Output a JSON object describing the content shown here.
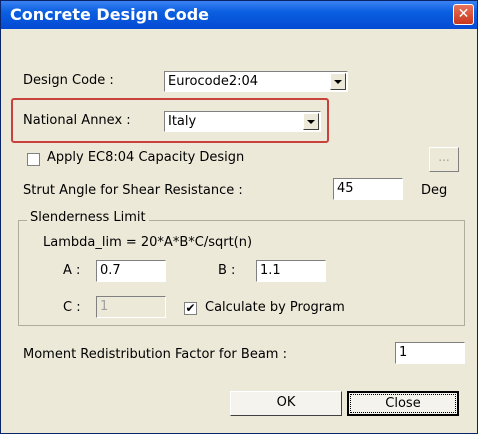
{
  "window": {
    "title": "Concrete Design Code",
    "close_label": "✕"
  },
  "design_code": {
    "label": "Design Code :",
    "value": "Eurocode2:04"
  },
  "national_annex": {
    "label": "National Annex :",
    "value": "Italy"
  },
  "capacity_design": {
    "label": "Apply EC8:04 Capacity Design",
    "checked": false,
    "ellipsis_label": "..."
  },
  "strut_angle": {
    "label": "Strut Angle for Shear Resistance :",
    "value": "45",
    "unit": "Deg"
  },
  "slenderness": {
    "title": "Slenderness Limit",
    "formula": "Lambda_lim = 20*A*B*C/sqrt(n)",
    "a_label": "A :",
    "a_value": "0.7",
    "b_label": "B :",
    "b_value": "1.1",
    "c_label": "C :",
    "c_value": "1",
    "calc_label": "Calculate by Program",
    "calc_checked": true
  },
  "moment": {
    "label": "Moment Redistribution Factor for Beam :",
    "value": "1"
  },
  "buttons": {
    "ok": "OK",
    "close": "Close"
  },
  "colors": {
    "title_bar": "#0549d3",
    "highlight": "#c8413b",
    "dialog_bg": "#ece9d8"
  }
}
